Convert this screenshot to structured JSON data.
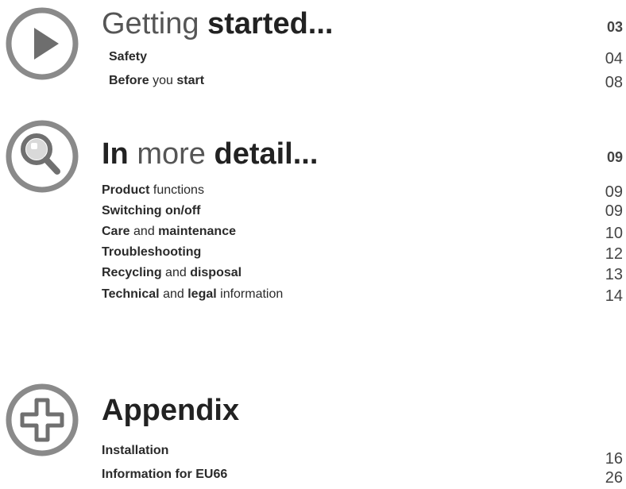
{
  "sections": [
    {
      "title_parts": [
        "Getting ",
        "started..."
      ],
      "page": "03",
      "entries": [
        {
          "parts": [
            "Safety"
          ],
          "page": "04"
        },
        {
          "parts": [
            "Before",
            " you ",
            "start"
          ],
          "page": "08"
        }
      ]
    },
    {
      "title_parts": [
        "In",
        " more ",
        "detail..."
      ],
      "page": "09",
      "entries": [
        {
          "parts": [
            "Product",
            " functions"
          ],
          "page": "09"
        },
        {
          "parts": [
            "Switching on/off"
          ],
          "page": "09"
        },
        {
          "parts": [
            "Care",
            " and ",
            "maintenance"
          ],
          "page": "10"
        },
        {
          "parts": [
            "Troubleshooting"
          ],
          "page": "12"
        },
        {
          "parts": [
            "Recycling",
            " and ",
            "disposal"
          ],
          "page": "13"
        },
        {
          "parts": [
            "Technical",
            " and ",
            "legal",
            " information"
          ],
          "page": "14"
        }
      ]
    },
    {
      "title_parts": [
        "Appendix"
      ],
      "entries": [
        {
          "parts": [
            "Installation"
          ],
          "page": "16"
        },
        {
          "parts": [
            "Information for EU66"
          ],
          "page": "26"
        }
      ]
    }
  ],
  "colors": {
    "icon_ring": "#8a8a8a",
    "icon_fill": "#7a7a7a",
    "text_dark": "#222222"
  },
  "icons": [
    "play-icon",
    "magnifier-icon",
    "plus-icon"
  ]
}
